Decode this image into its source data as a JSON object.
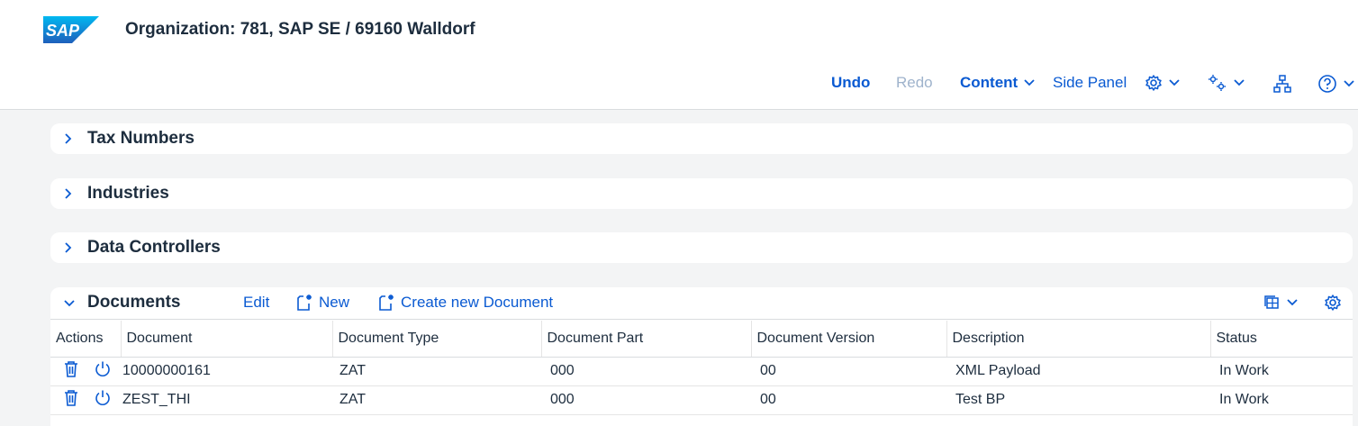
{
  "header": {
    "logo_text": "SAP",
    "title": "Organization: 781, SAP SE / 69160 Walldorf"
  },
  "toolbar": {
    "undo": "Undo",
    "redo": "Redo",
    "content": "Content",
    "side_panel": "Side Panel"
  },
  "sections": [
    {
      "title": "Tax Numbers"
    },
    {
      "title": "Industries"
    },
    {
      "title": "Data Controllers"
    }
  ],
  "documents": {
    "title": "Documents",
    "edit": "Edit",
    "new": "New",
    "create_new": "Create new Document",
    "columns": [
      "Actions",
      "Document",
      "Document Type",
      "Document Part",
      "Document Version",
      "Description",
      "Status"
    ],
    "rows": [
      {
        "document": "10000000161",
        "type": "ZAT",
        "part": "000",
        "version": "00",
        "description": "XML Payload",
        "status": "In Work"
      },
      {
        "document": "ZEST_THI",
        "type": "ZAT",
        "part": "000",
        "version": "00",
        "description": "Test BP",
        "status": "In Work"
      }
    ]
  },
  "colors": {
    "brand_blue": "#0a5ad2",
    "text": "#1d2d3e",
    "disabled": "#9fb3cc"
  }
}
